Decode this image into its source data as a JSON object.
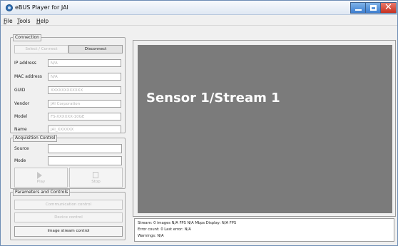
{
  "window": {
    "title": "eBUS Player for JAI"
  },
  "menu": [
    "File",
    "Tools",
    "Help"
  ],
  "connection": {
    "title": "Connection",
    "select_label": "Select / Connect",
    "disconnect_label": "Disconnect",
    "fields": [
      {
        "label": "IP address",
        "value": "N/A"
      },
      {
        "label": "MAC address",
        "value": "N/A"
      },
      {
        "label": "GUID",
        "value": "XXXXXXXXXXXX"
      },
      {
        "label": "Vendor",
        "value": "JAI Corporation"
      },
      {
        "label": "Model",
        "value": "FS-XXXXXX-10GE"
      },
      {
        "label": "Name",
        "value": "JAI_XXXXXX"
      }
    ]
  },
  "acquisition": {
    "title": "Acquisition Control",
    "source_label": "Source",
    "mode_label": "Mode",
    "play_label": "Play",
    "stop_label": "Stop"
  },
  "parameters": {
    "title": "Parameters and Controls",
    "communication_label": "Communication control",
    "device_label": "Device control",
    "image_stream_label": "Image stream control"
  },
  "display": {
    "stream_label": "Sensor 1/Stream 1"
  },
  "status": {
    "line1": "Stream: 0 images   N/A FPS   N/A Mbps   Display: N/A FPS",
    "line2": "Error count: 0   Last error: N/A",
    "line3": "Warnings: N/A"
  },
  "colors": {
    "titlebar": "#dfe8f3",
    "close": "#c7301f",
    "display": "#7b7b7b"
  },
  "icons": [
    "app-icon",
    "minimize-icon",
    "maximize-icon",
    "close-icon",
    "play-icon",
    "stop-icon"
  ]
}
